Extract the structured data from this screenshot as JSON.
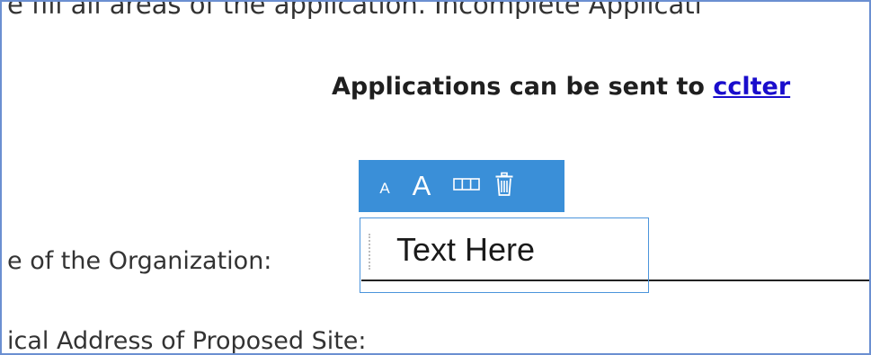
{
  "document": {
    "top_line": "e fill all areas of the application.  Incomplete Applicati",
    "send_prefix": "Applications can be sent to ",
    "send_email": "cclter",
    "org_label": "e of the Organization:",
    "address_label": "ical Address of Proposed Site:"
  },
  "toolbar": {
    "decrease_font_label": "A",
    "increase_font_label": "A",
    "width_icon": "column-width-icon",
    "delete_icon": "trash-icon"
  },
  "text_field": {
    "value": "Text Here"
  },
  "colors": {
    "toolbar_bg": "#3a8fd8",
    "selection_border": "#4b94dc",
    "link": "#1a0dcc",
    "frame_border": "#6b8fd1"
  }
}
